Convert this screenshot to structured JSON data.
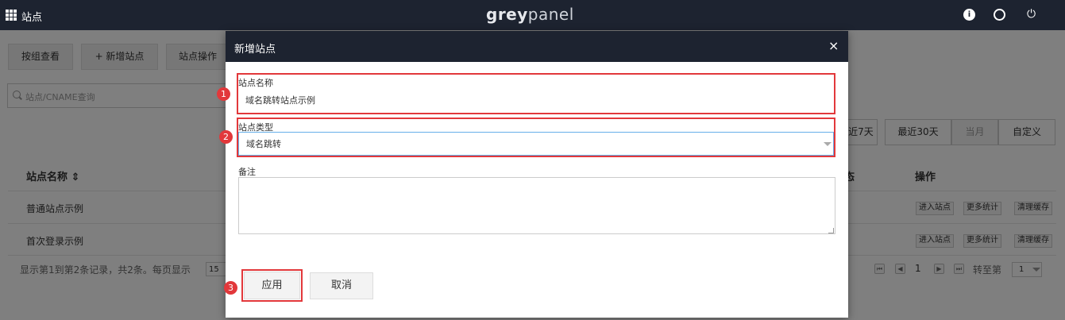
{
  "topbar": {
    "title": "站点",
    "logo_a": "grey",
    "logo_b": "panel",
    "info_icon": "info-icon",
    "user_icon": "user-icon",
    "power_icon": "power-icon"
  },
  "toolbar": {
    "group_view": "按组查看",
    "add_site": "+ 新增站点",
    "site_ops": "站点操作"
  },
  "search": {
    "placeholder": "站点/CNAME查询"
  },
  "range": {
    "last7": "近7天",
    "last30": "最近30天",
    "this_month": "当月",
    "custom": "自定义"
  },
  "table": {
    "headers": {
      "name": "站点名称 ⇕",
      "status": "态",
      "actions": "操作"
    },
    "rows": [
      {
        "name": "普通站点示例",
        "actions": [
          "进入站点",
          "更多统计",
          "清理缓存"
        ]
      },
      {
        "name": "首次登录示例",
        "actions": [
          "进入站点",
          "更多统计",
          "清理缓存"
        ]
      }
    ],
    "footer": "显示第1到第2条记录，共2条。每页显示",
    "page_size": "15"
  },
  "pagination": {
    "current": "1",
    "goto_label": "转至第",
    "goto_value": "1"
  },
  "modal": {
    "title": "新增站点",
    "close": "×",
    "name_label": "站点名称",
    "name_value": "域名跳转站点示例",
    "type_label": "站点类型",
    "type_value": "域名跳转",
    "note_label": "备注",
    "note_value": "",
    "apply": "应用",
    "cancel": "取消"
  },
  "markers": [
    "1",
    "2",
    "3"
  ],
  "colors": {
    "header_bg": "#1d2330",
    "highlight": "#e2383b"
  }
}
